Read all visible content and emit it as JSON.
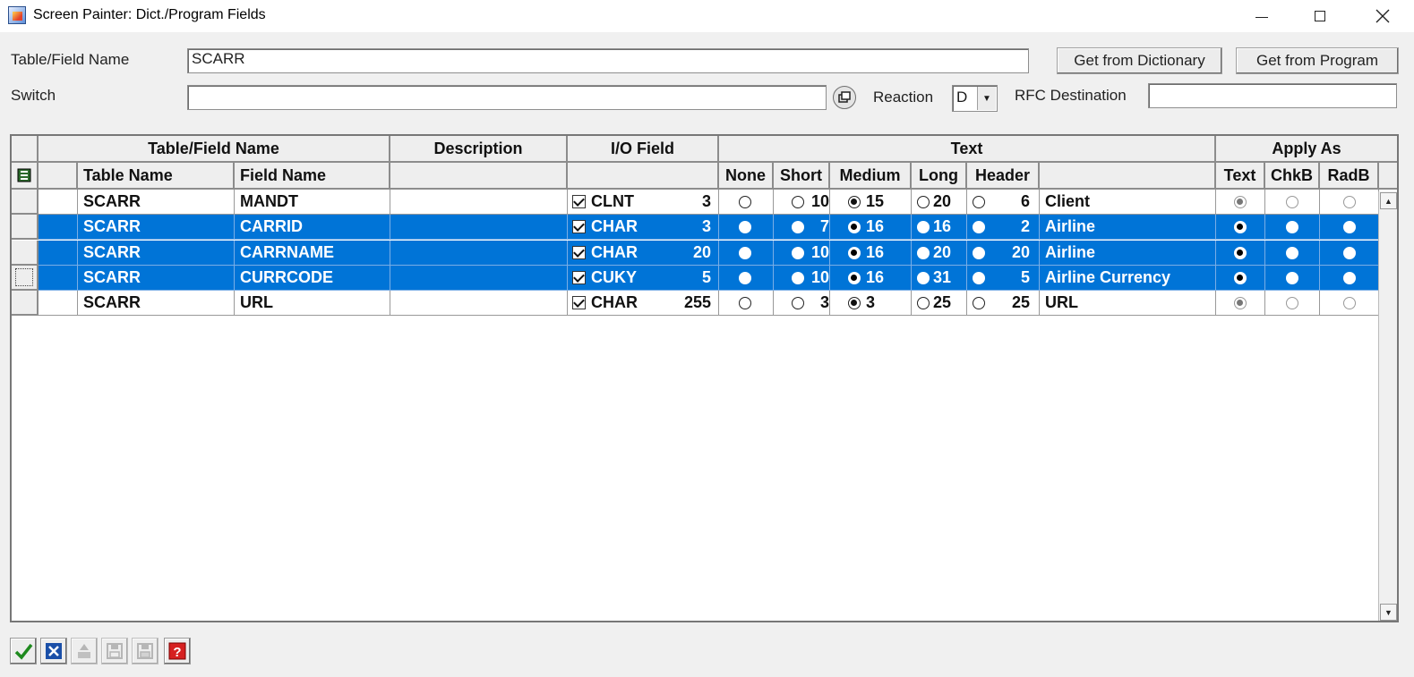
{
  "window": {
    "title": "Screen Painter: Dict./Program Fields"
  },
  "form": {
    "table_field_label": "Table/Field Name",
    "table_field_value": "SCARR",
    "switch_label": "Switch",
    "switch_value": "",
    "reaction_label": "Reaction",
    "reaction_value": "D",
    "rfc_label": "RFC Destination",
    "rfc_value": "",
    "get_dict_label": "Get from Dictionary",
    "get_prog_label": "Get from Program"
  },
  "grid": {
    "group_headers": {
      "table_field": "Table/Field Name",
      "description": "Description",
      "io_field": "I/O Field",
      "text": "Text",
      "apply_as": "Apply As"
    },
    "sub_headers": {
      "table_name": "Table Name",
      "field_name": "Field Name",
      "none": "None",
      "short": "Short",
      "medium": "Medium",
      "long": "Long",
      "header": "Header",
      "text": "Text",
      "chkb": "ChkB",
      "radb": "RadB"
    },
    "rows": [
      {
        "table": "SCARR",
        "field": "MANDT",
        "description": "",
        "io_checked": true,
        "type": "CLNT",
        "length": "3",
        "short": "10",
        "medium": "15",
        "long": "20",
        "header": "6",
        "text_selected": "medium",
        "text": "Client",
        "apply_as": "text",
        "selected": false
      },
      {
        "table": "SCARR",
        "field": "CARRID",
        "description": "",
        "io_checked": true,
        "type": "CHAR",
        "length": "3",
        "short": "7",
        "medium": "16",
        "long": "16",
        "header": "2",
        "text_selected": "medium",
        "text": "Airline",
        "apply_as": "text",
        "selected": true
      },
      {
        "table": "SCARR",
        "field": "CARRNAME",
        "description": "",
        "io_checked": true,
        "type": "CHAR",
        "length": "20",
        "short": "10",
        "medium": "16",
        "long": "20",
        "header": "20",
        "text_selected": "medium",
        "text": "Airline",
        "apply_as": "text",
        "selected": true
      },
      {
        "table": "SCARR",
        "field": "CURRCODE",
        "description": "",
        "io_checked": true,
        "type": "CUKY",
        "length": "5",
        "short": "10",
        "medium": "16",
        "long": "31",
        "header": "5",
        "text_selected": "medium",
        "text": "Airline Currency",
        "apply_as": "text",
        "selected": true
      },
      {
        "table": "SCARR",
        "field": "URL",
        "description": "",
        "io_checked": true,
        "type": "CHAR",
        "length": "255",
        "short": "3",
        "medium": "3",
        "long": "25",
        "header": "25",
        "text_selected": "medium",
        "text": "URL",
        "apply_as": "text",
        "selected": false
      }
    ]
  },
  "toolbar": {
    "icons": [
      "checkmark-icon",
      "cancel-icon",
      "hierarchy-icon",
      "save-icon",
      "save-as-icon",
      "help-icon"
    ]
  },
  "colors": {
    "selection": "#0074d7",
    "background": "#f0f0f0"
  }
}
